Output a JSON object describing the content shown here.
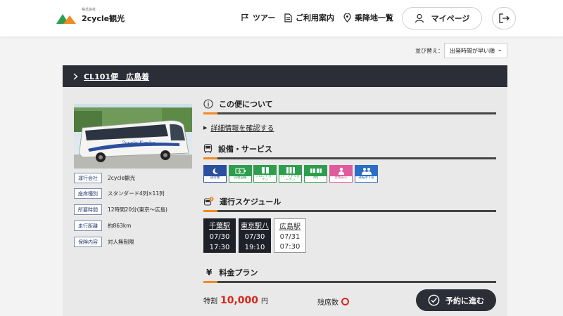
{
  "header": {
    "logo_ruby": "株式会社",
    "logo_text": "2cycle観光",
    "nav": [
      {
        "label": "ツアー",
        "icon": "flag-icon"
      },
      {
        "label": "ご利用案内",
        "icon": "document-icon"
      },
      {
        "label": "乗降地一覧",
        "icon": "map-pin-icon"
      }
    ],
    "mypage_label": "マイページ",
    "logout_icon": "logout-icon"
  },
  "sort": {
    "label": "並び替え：",
    "selected": "出発時間が早い順"
  },
  "trip": {
    "title": "CL101便　広島着",
    "bus_livery": "2cycle Kanko",
    "info": [
      {
        "tag": "運行会社",
        "value": "2cycle観光"
      },
      {
        "tag": "座席種別",
        "value": "スタンダード4列×11列"
      },
      {
        "tag": "所要時間",
        "value": "12時間20分(東京～広島)"
      },
      {
        "tag": "走行距離",
        "value": "約863km"
      },
      {
        "tag": "保険内容",
        "value": "対人無制限"
      }
    ],
    "about_title": "この便について",
    "detail_link": "詳細情報を確認する",
    "amenities_title": "設備・サービス",
    "amenities": [
      {
        "label": "夜行便",
        "color": "#2a4f9e",
        "icon": "moon-icon"
      },
      {
        "label": "充電設備",
        "color": "#2e9e4e",
        "icon": "battery-icon"
      },
      {
        "label": "フロントカーテン",
        "color": "#2e9e4e",
        "icon": "front-curtain-icon"
      },
      {
        "label": "パーソナルカーテン",
        "color": "#2e9e4e",
        "icon": "personal-curtain-icon"
      },
      {
        "label": "4列",
        "color": "#2e9e4e",
        "icon": "seats-4-row-icon"
      },
      {
        "label": "女性安心",
        "color": "#e05a9e",
        "icon": "female-icon"
      },
      {
        "label": "運転手２名",
        "color": "#2a6fc4",
        "icon": "two-drivers-icon"
      }
    ],
    "schedule_title": "運行スケジュール",
    "stops": [
      {
        "name": "千葉駅",
        "date": "07/30",
        "time": "17:30",
        "style": "dark"
      },
      {
        "name": "東京駅八",
        "date": "07/30",
        "time": "19:10",
        "style": "dark"
      },
      {
        "name": "広島駅",
        "date": "07/31",
        "time": "07:30",
        "style": "light"
      }
    ],
    "fare_title": "料金プラン",
    "fare_yen_symbol": "¥",
    "fare_label": "特割",
    "fare_price": "10,000",
    "fare_unit": "円",
    "seats_label": "残席数",
    "reserve_label": "予約に進む"
  },
  "colors": {
    "accent": "#f08a24",
    "dark": "#2b2e36",
    "price": "#d9261c"
  }
}
